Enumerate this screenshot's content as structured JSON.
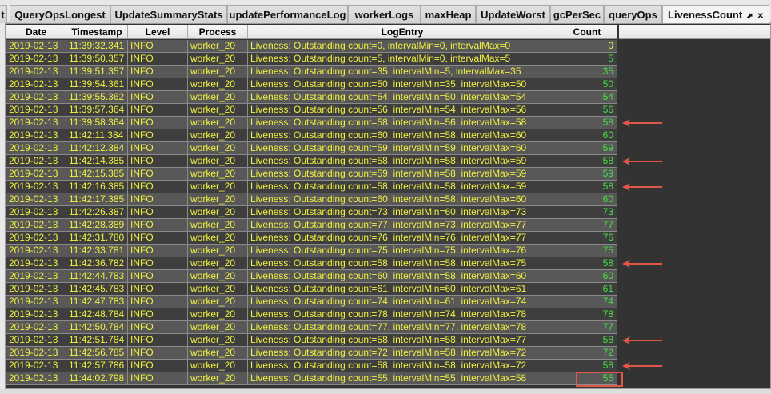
{
  "tabs": [
    {
      "label": "t"
    },
    {
      "label": "QueryOpsLongest"
    },
    {
      "label": "UpdateSummaryStats"
    },
    {
      "label": "updatePerformanceLog"
    },
    {
      "label": "workerLogs"
    },
    {
      "label": "maxHeap"
    },
    {
      "label": "UpdateWorst"
    },
    {
      "label": "gcPerSec"
    },
    {
      "label": "queryOps"
    },
    {
      "label": "LivenessCount",
      "active": true
    }
  ],
  "columns": [
    "Date",
    "Timestamp",
    "Level",
    "Process",
    "LogEntry",
    "Count"
  ],
  "highlight_color": "#e0574a",
  "rows": [
    [
      "2019-02-13",
      "11:39:32.341",
      "INFO",
      "worker_20",
      "Liveness: Outstanding count=0, intervalMin=0, intervalMax=0",
      "0"
    ],
    [
      "2019-02-13",
      "11:39:50.357",
      "INFO",
      "worker_20",
      "Liveness: Outstanding count=5, intervalMin=0, intervalMax=5",
      "5"
    ],
    [
      "2019-02-13",
      "11:39:51.357",
      "INFO",
      "worker_20",
      "Liveness: Outstanding count=35, intervalMin=5, intervalMax=35",
      "35"
    ],
    [
      "2019-02-13",
      "11:39:54.361",
      "INFO",
      "worker_20",
      "Liveness: Outstanding count=50, intervalMin=35, intervalMax=50",
      "50"
    ],
    [
      "2019-02-13",
      "11:39:55.362",
      "INFO",
      "worker_20",
      "Liveness: Outstanding count=54, intervalMin=50, intervalMax=54",
      "54"
    ],
    [
      "2019-02-13",
      "11:39:57.364",
      "INFO",
      "worker_20",
      "Liveness: Outstanding count=56, intervalMin=54, intervalMax=56",
      "56"
    ],
    [
      "2019-02-13",
      "11:39:58.364",
      "INFO",
      "worker_20",
      "Liveness: Outstanding count=58, intervalMin=56, intervalMax=58",
      "58"
    ],
    [
      "2019-02-13",
      "11:42:11.384",
      "INFO",
      "worker_20",
      "Liveness: Outstanding count=60, intervalMin=58, intervalMax=60",
      "60"
    ],
    [
      "2019-02-13",
      "11:42:12.384",
      "INFO",
      "worker_20",
      "Liveness: Outstanding count=59, intervalMin=59, intervalMax=60",
      "59"
    ],
    [
      "2019-02-13",
      "11:42:14.385",
      "INFO",
      "worker_20",
      "Liveness: Outstanding count=58, intervalMin=58, intervalMax=59",
      "58"
    ],
    [
      "2019-02-13",
      "11:42:15.385",
      "INFO",
      "worker_20",
      "Liveness: Outstanding count=59, intervalMin=58, intervalMax=59",
      "59"
    ],
    [
      "2019-02-13",
      "11:42:16.385",
      "INFO",
      "worker_20",
      "Liveness: Outstanding count=58, intervalMin=58, intervalMax=59",
      "58"
    ],
    [
      "2019-02-13",
      "11:42:17.385",
      "INFO",
      "worker_20",
      "Liveness: Outstanding count=60, intervalMin=58, intervalMax=60",
      "60"
    ],
    [
      "2019-02-13",
      "11:42:26.387",
      "INFO",
      "worker_20",
      "Liveness: Outstanding count=73, intervalMin=60, intervalMax=73",
      "73"
    ],
    [
      "2019-02-13",
      "11:42:28.389",
      "INFO",
      "worker_20",
      "Liveness: Outstanding count=77, intervalMin=73, intervalMax=77",
      "77"
    ],
    [
      "2019-02-13",
      "11:42:31.780",
      "INFO",
      "worker_20",
      "Liveness: Outstanding count=76, intervalMin=76, intervalMax=77",
      "76"
    ],
    [
      "2019-02-13",
      "11:42:33.781",
      "INFO",
      "worker_20",
      "Liveness: Outstanding count=75, intervalMin=75, intervalMax=76",
      "75"
    ],
    [
      "2019-02-13",
      "11:42:36.782",
      "INFO",
      "worker_20",
      "Liveness: Outstanding count=58, intervalMin=58, intervalMax=75",
      "58"
    ],
    [
      "2019-02-13",
      "11:42:44.783",
      "INFO",
      "worker_20",
      "Liveness: Outstanding count=60, intervalMin=58, intervalMax=60",
      "60"
    ],
    [
      "2019-02-13",
      "11:42:45.783",
      "INFO",
      "worker_20",
      "Liveness: Outstanding count=61, intervalMin=60, intervalMax=61",
      "61"
    ],
    [
      "2019-02-13",
      "11:42:47.783",
      "INFO",
      "worker_20",
      "Liveness: Outstanding count=74, intervalMin=61, intervalMax=74",
      "74"
    ],
    [
      "2019-02-13",
      "11:42:48.784",
      "INFO",
      "worker_20",
      "Liveness: Outstanding count=78, intervalMin=74, intervalMax=78",
      "78"
    ],
    [
      "2019-02-13",
      "11:42:50.784",
      "INFO",
      "worker_20",
      "Liveness: Outstanding count=77, intervalMin=77, intervalMax=78",
      "77"
    ],
    [
      "2019-02-13",
      "11:42:51.784",
      "INFO",
      "worker_20",
      "Liveness: Outstanding count=58, intervalMin=58, intervalMax=77",
      "58"
    ],
    [
      "2019-02-13",
      "11:42:56.785",
      "INFO",
      "worker_20",
      "Liveness: Outstanding count=72, intervalMin=58, intervalMax=72",
      "72"
    ],
    [
      "2019-02-13",
      "11:42:57.786",
      "INFO",
      "worker_20",
      "Liveness: Outstanding count=58, intervalMin=58, intervalMax=72",
      "58"
    ],
    [
      "2019-02-13",
      "11:44:02.798",
      "INFO",
      "worker_20",
      "Liveness: Outstanding count=55, intervalMin=55, intervalMax=58",
      "55"
    ]
  ],
  "arrow_rows": [
    6,
    9,
    11,
    17,
    23,
    25
  ],
  "boxed_row": 26
}
